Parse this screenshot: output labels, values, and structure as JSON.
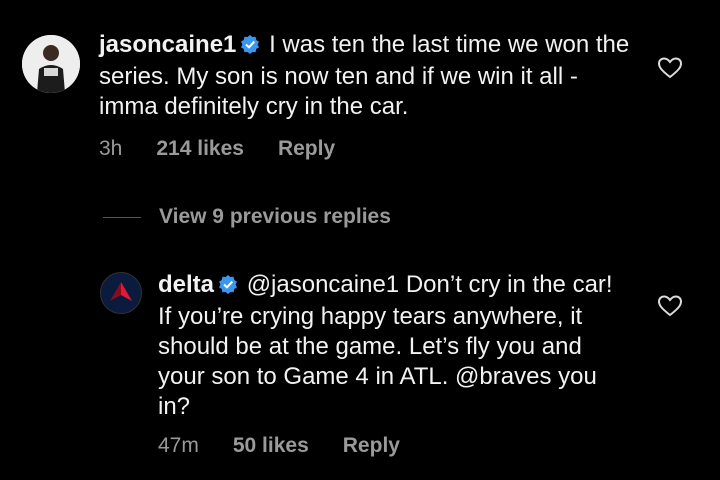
{
  "comments": [
    {
      "username": "jasoncaine1",
      "text": "I was ten the last time we won the series. My son is now ten and if we win it all - imma definitely cry in the car.",
      "time": "3h",
      "likes": "214 likes",
      "reply_label": "Reply"
    },
    {
      "username": "delta",
      "mention": "@jasoncaine1",
      "text_part1": "Don’t cry in the car! If you’re crying happy tears anywhere, it should be at the game. Let’s fly you and your son to Game 4 in ATL.",
      "mention2": "@braves",
      "text_part2": "you in?",
      "time": "47m",
      "likes": "50 likes",
      "reply_label": "Reply"
    }
  ],
  "view_replies_label": "View 9 previous replies",
  "colors": {
    "background": "#000000",
    "text": "#f2f2f2",
    "meta": "#9a9a9a",
    "verified": "#3897f0",
    "delta_red": "#c8102e"
  },
  "icons": [
    "verified-badge-icon",
    "heart-icon"
  ]
}
